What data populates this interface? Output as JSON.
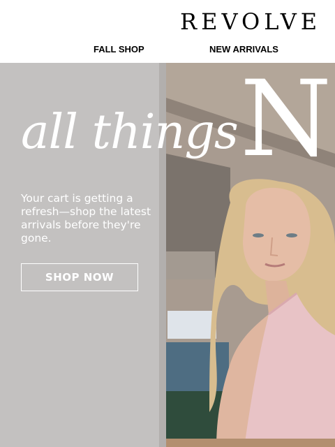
{
  "header": {
    "logo": "REVOLVE",
    "nav": {
      "fall_shop": "FALL SHOP",
      "new_arrivals": "NEW ARRIVALS"
    }
  },
  "hero": {
    "headline_script": "all things",
    "headline_serif": "NE",
    "body": "Your cart is getting a refresh—shop the latest arrivals before they're gone.",
    "cta": "SHOP NOW"
  },
  "colors": {
    "header_bg": "#ffffff",
    "text_dark": "#000000",
    "hero_text": "#ffffff",
    "wall": "#c2c0bf",
    "top_dress": "#e8c3c6",
    "hair": "#d6bb8e"
  }
}
